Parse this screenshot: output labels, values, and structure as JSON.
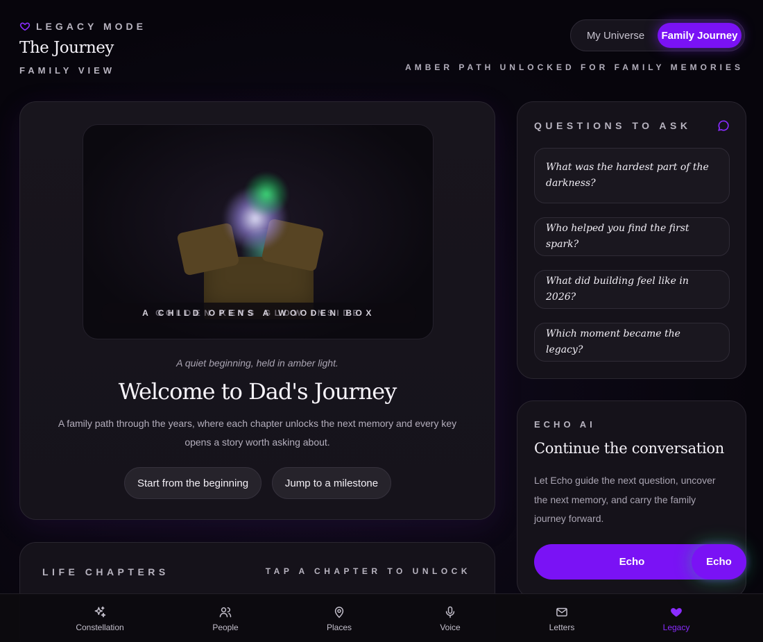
{
  "header": {
    "mode_label": "LEGACY MODE",
    "title": "The Journey",
    "subtitle": "FAMILY VIEW",
    "status": "AMBER PATH UNLOCKED FOR FAMILY MEMORIES"
  },
  "toggle": {
    "options": [
      {
        "label": "My Universe",
        "active": false
      },
      {
        "label": "Family Journey",
        "active": true
      }
    ]
  },
  "hero": {
    "scene_caption": "A CHILD OPENS A WOODEN BOX",
    "scene_caption_overlay": "GOLDEN KEYS GLOW INSIDE",
    "tagline": "A quiet beginning, held in amber light.",
    "title": "Welcome to Dad's Journey",
    "description": "A family path through the years, where each chapter unlocks the next memory and every key opens a story worth asking about.",
    "buttons": [
      "Start from the beginning",
      "Jump to a milestone"
    ]
  },
  "chapters": {
    "label": "LIFE CHAPTERS",
    "hint": "TAP A CHAPTER TO UNLOCK"
  },
  "questions": {
    "label": "QUESTIONS TO ASK",
    "items": [
      "What was the hardest part of the darkness?",
      "Who helped you find the first spark?",
      "What did building feel like in 2026?",
      "Which moment became the legacy?"
    ]
  },
  "echo": {
    "label": "ECHO AI",
    "title": "Continue the conversation",
    "description": "Let Echo guide the next question, uncover the next memory, and carry the family journey forward.",
    "button": "Echo",
    "fab": "Echo"
  },
  "nav": {
    "items": [
      {
        "label": "Constellation",
        "icon": "sparkles-icon"
      },
      {
        "label": "People",
        "icon": "people-icon"
      },
      {
        "label": "Places",
        "icon": "map-pin-icon"
      },
      {
        "label": "Voice",
        "icon": "microphone-icon"
      },
      {
        "label": "Letters",
        "icon": "envelope-icon"
      },
      {
        "label": "Legacy",
        "icon": "heart-icon",
        "active": true
      }
    ]
  },
  "colors": {
    "accent": "#7a12f5",
    "active_nav": "#8a2cff",
    "background": "#07050c"
  }
}
